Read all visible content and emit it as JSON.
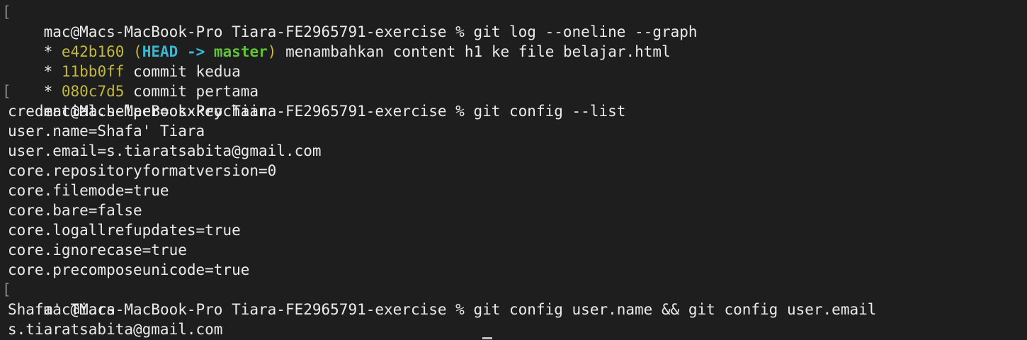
{
  "terminal": {
    "prompt_mark": "[",
    "commands": [
      {
        "prompt": "mac@Macs-MacBook-Pro Tiara-FE2965791-exercise % ",
        "command": "git log --oneline --graph"
      },
      {
        "prompt": "mac@Macs-MacBook-Pro Tiara-FE2965791-exercise % ",
        "command": "git config --list"
      },
      {
        "prompt": "mac@Macs-MacBook-Pro Tiara-FE2965791-exercise % ",
        "command": "git config user.name && git config user.email"
      }
    ],
    "log": [
      {
        "graph": "* ",
        "hash": "e42b160",
        "head": "HEAD",
        "arrow": "->",
        "branch": "master",
        "message": "menambahkan content h1 ke file belajar.html"
      },
      {
        "graph": "* ",
        "hash": "11bb0ff",
        "message": "commit kedua"
      },
      {
        "graph": "* ",
        "hash": "080c7d5",
        "message": "commit pertama"
      }
    ],
    "config_list": [
      "credential.helper=osxkeychain",
      "user.name=Shafa' Tiara",
      "user.email=s.tiaratsabita@gmail.com",
      "core.repositoryformatversion=0",
      "core.filemode=true",
      "core.bare=false",
      "core.logallrefupdates=true",
      "core.ignorecase=true",
      "core.precomposeunicode=true"
    ],
    "user_output": [
      "Shafa' Tiara",
      "s.tiaratsabita@gmail.com"
    ],
    "colors": {
      "background": "#1e1e1e",
      "text": "#ebebeb",
      "hash": "#c4b93f",
      "head": "#36b9d3",
      "branch": "#5fc436"
    }
  }
}
